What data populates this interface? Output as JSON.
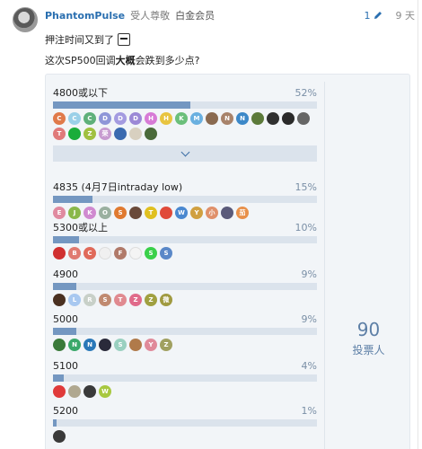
{
  "post": {
    "username": "PhantomPulse",
    "user_title": "受人尊敬",
    "user_group": "白金会员",
    "edit_count": "1",
    "age": "9 天",
    "line1": "押注时间又到了",
    "line2_pre": "这次SP500回调",
    "line2_bold": "大概",
    "line2_post": "会跌到多少点?"
  },
  "poll": {
    "total_votes": "90",
    "total_label": "投票人",
    "options": [
      {
        "label": "4800或以下",
        "pct_text": "52%",
        "pct": 0.52,
        "voters": [
          {
            "t": "C",
            "c": "#e07a4a"
          },
          {
            "t": "C",
            "c": "#9ad0e8"
          },
          {
            "t": "C",
            "c": "#5fb07a"
          },
          {
            "t": "D",
            "c": "#8e96d8"
          },
          {
            "t": "D",
            "c": "#a49be0"
          },
          {
            "t": "D",
            "c": "#9b88d6"
          },
          {
            "t": "H",
            "c": "#d77bd6"
          },
          {
            "t": "H",
            "c": "#e8c440"
          },
          {
            "t": "K",
            "c": "#6bbf7a"
          },
          {
            "t": "M",
            "c": "#6ab0e0"
          },
          {
            "t": "",
            "c": "#8a6a50"
          },
          {
            "t": "N",
            "c": "#a8836b"
          },
          {
            "t": "N",
            "c": "#3c88c8"
          },
          {
            "t": "",
            "c": "#5c7a3a"
          },
          {
            "t": "",
            "c": "#303030"
          },
          {
            "t": "",
            "c": "#2a2a2a"
          },
          {
            "t": "",
            "c": "#666666"
          },
          {
            "t": "T",
            "c": "#e07a7a"
          },
          {
            "t": "",
            "c": "#1aad3a"
          },
          {
            "t": "Z",
            "c": "#a0c040"
          },
          {
            "t": "荣",
            "c": "#c79bd0"
          },
          {
            "t": "",
            "c": "#3a6ab0"
          },
          {
            "t": "",
            "c": "#d8d0c0"
          },
          {
            "t": "",
            "c": "#4a6a3a"
          }
        ]
      },
      {
        "label": "4835 (4月7日intraday low)",
        "pct_text": "15%",
        "pct": 0.15,
        "voters": [
          {
            "t": "E",
            "c": "#e08aa0"
          },
          {
            "t": "J",
            "c": "#8ab84a"
          },
          {
            "t": "K",
            "c": "#d08ad0"
          },
          {
            "t": "O",
            "c": "#9ab0a0"
          },
          {
            "t": "S",
            "c": "#e07a30"
          },
          {
            "t": "",
            "c": "#6a4a3a"
          },
          {
            "t": "T",
            "c": "#e0c020"
          },
          {
            "t": "",
            "c": "#e04a3a"
          },
          {
            "t": "W",
            "c": "#4a88d0"
          },
          {
            "t": "Y",
            "c": "#d0a040"
          },
          {
            "t": "小",
            "c": "#e0906a"
          },
          {
            "t": "",
            "c": "#5a5a7a"
          },
          {
            "t": "茄",
            "c": "#e8904a"
          }
        ]
      },
      {
        "label": "5300或以上",
        "pct_text": "10%",
        "pct": 0.1,
        "voters": [
          {
            "t": "",
            "c": "#d03030"
          },
          {
            "t": "B",
            "c": "#e07a70"
          },
          {
            "t": "C",
            "c": "#e06a5a"
          },
          {
            "t": "",
            "c": "#f0f0f0"
          },
          {
            "t": "F",
            "c": "#b07a6a"
          },
          {
            "t": "",
            "c": "#f4f4f4"
          },
          {
            "t": "S",
            "c": "#3ad04a"
          },
          {
            "t": "S",
            "c": "#5a88c8"
          }
        ]
      },
      {
        "label": "4900",
        "pct_text": "9%",
        "pct": 0.09,
        "voters": [
          {
            "t": "",
            "c": "#4a3020"
          },
          {
            "t": "L",
            "c": "#a8c8f0"
          },
          {
            "t": "R",
            "c": "#c8d0c8"
          },
          {
            "t": "S",
            "c": "#c08a70"
          },
          {
            "t": "T",
            "c": "#e08a90"
          },
          {
            "t": "Z",
            "c": "#e06a8a"
          },
          {
            "t": "Z",
            "c": "#a0a040"
          },
          {
            "t": "微",
            "c": "#a09a40"
          }
        ]
      },
      {
        "label": "5000",
        "pct_text": "9%",
        "pct": 0.09,
        "voters": [
          {
            "t": "",
            "c": "#3a7a3a"
          },
          {
            "t": "N",
            "c": "#3aa86a"
          },
          {
            "t": "N",
            "c": "#2a78b8"
          },
          {
            "t": "",
            "c": "#2a2a3a"
          },
          {
            "t": "S",
            "c": "#9ad0c0"
          },
          {
            "t": "",
            "c": "#b07a4a"
          },
          {
            "t": "Y",
            "c": "#e08a9a"
          },
          {
            "t": "Z",
            "c": "#a0a060"
          }
        ]
      },
      {
        "label": "5100",
        "pct_text": "4%",
        "pct": 0.04,
        "voters": [
          {
            "t": "",
            "c": "#e03a3a"
          },
          {
            "t": "",
            "c": "#b0a890"
          },
          {
            "t": "",
            "c": "#3a3a3a"
          },
          {
            "t": "W",
            "c": "#a8c840"
          }
        ]
      },
      {
        "label": "5200",
        "pct_text": "1%",
        "pct": 0.01,
        "voters": [
          {
            "t": "",
            "c": "#3a3a3a"
          }
        ]
      }
    ]
  }
}
